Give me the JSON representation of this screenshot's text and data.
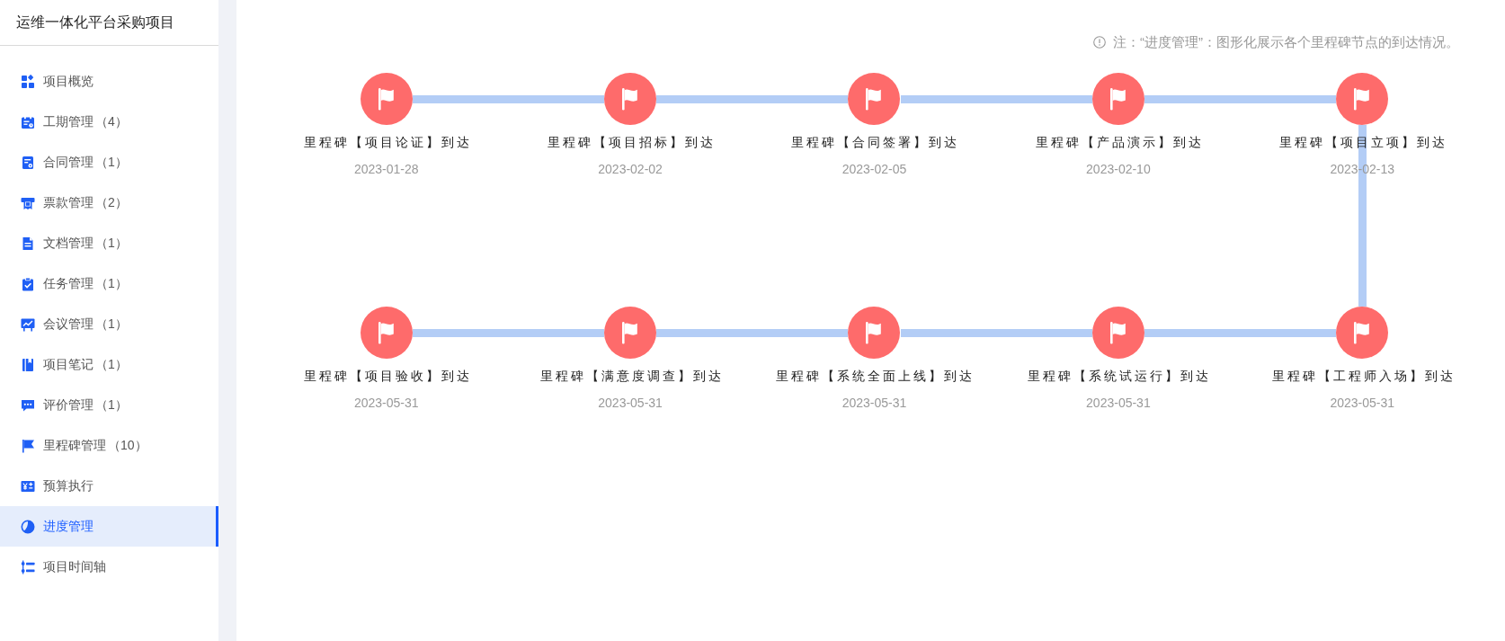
{
  "sidebar": {
    "title": "运维一体化平台采购项目",
    "items": [
      {
        "label": "项目概览",
        "selected": false
      },
      {
        "label": "工期管理",
        "count": "（4）",
        "selected": false
      },
      {
        "label": "合同管理",
        "count": "（1）",
        "selected": false
      },
      {
        "label": "票款管理",
        "count": "（2）",
        "selected": false
      },
      {
        "label": "文档管理",
        "count": "（1）",
        "selected": false
      },
      {
        "label": "任务管理",
        "count": "（1）",
        "selected": false
      },
      {
        "label": "会议管理",
        "count": "（1）",
        "selected": false
      },
      {
        "label": "项目笔记",
        "count": "（1）",
        "selected": false
      },
      {
        "label": "评价管理",
        "count": "（1）",
        "selected": false
      },
      {
        "label": "里程碑管理",
        "count": "（10）",
        "selected": false
      },
      {
        "label": "预算执行",
        "selected": false
      },
      {
        "label": "进度管理",
        "selected": true
      },
      {
        "label": "项目时间轴",
        "selected": false
      }
    ]
  },
  "note": {
    "text": "注：“进度管理”：图形化展示各个里程碑节点的到达情况。"
  },
  "milestone_rows": [
    {
      "milestones": [
        {
          "label": "里程碑【项目论证】到达",
          "date": "2023-01-28"
        },
        {
          "label": "里程碑【项目招标】到达",
          "date": "2023-02-02"
        },
        {
          "label": "里程碑【合同签署】到达",
          "date": "2023-02-05"
        },
        {
          "label": "里程碑【产品演示】到达",
          "date": "2023-02-10"
        },
        {
          "label": "里程碑【项目立项】到达",
          "date": "2023-02-13"
        }
      ]
    },
    {
      "milestones": [
        {
          "label": "里程碑【项目验收】到达",
          "date": "2023-05-31"
        },
        {
          "label": "里程碑【满意度调查】到达",
          "date": "2023-05-31"
        },
        {
          "label": "里程碑【系统全面上线】到达",
          "date": "2023-05-31"
        },
        {
          "label": "里程碑【系统试运行】到达",
          "date": "2023-05-31"
        },
        {
          "label": "里程碑【工程师入场】到达",
          "date": "2023-05-31"
        }
      ]
    }
  ]
}
